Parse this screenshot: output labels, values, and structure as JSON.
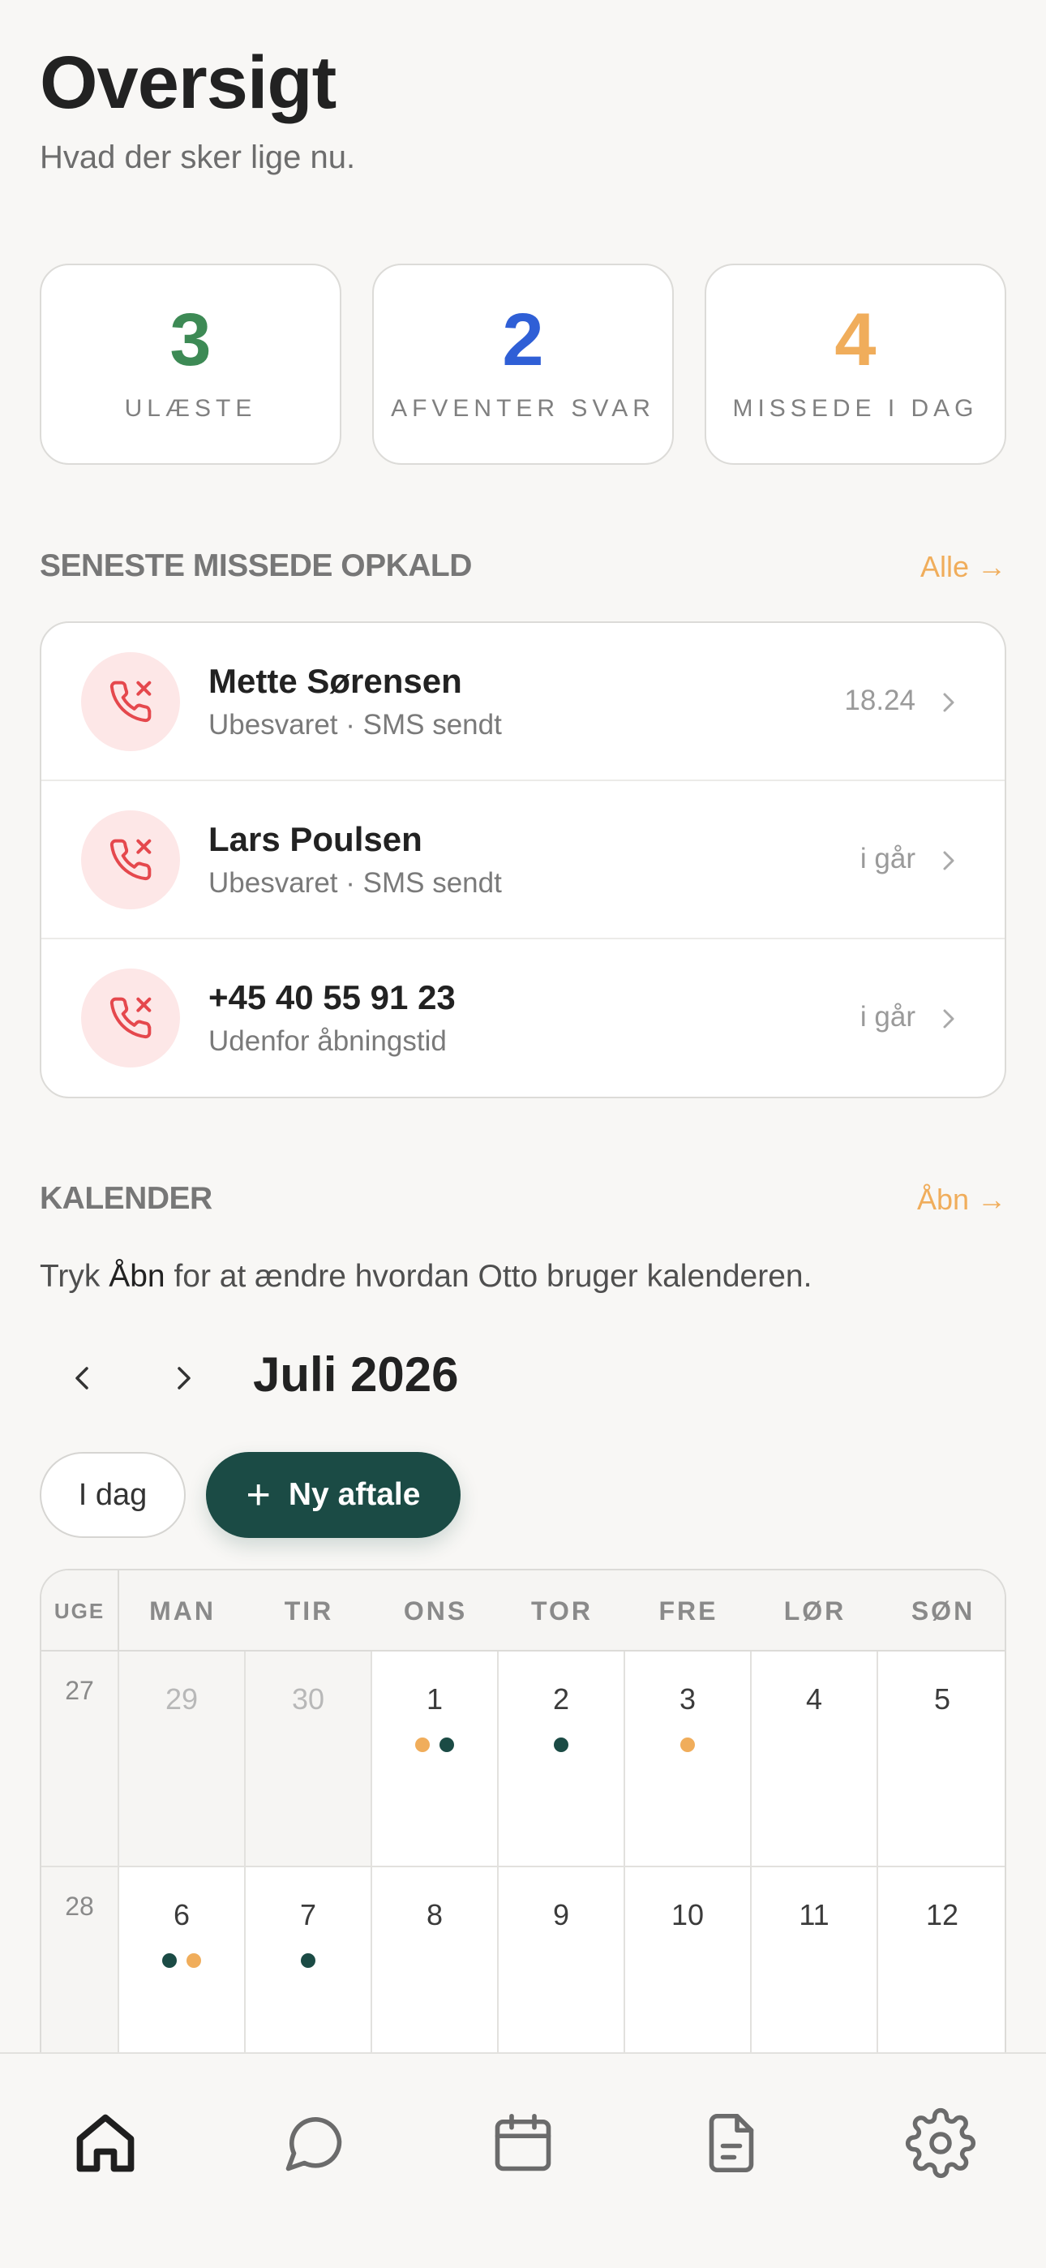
{
  "header": {
    "title": "Oversigt",
    "subtitle": "Hvad der sker lige nu."
  },
  "stats": [
    {
      "value": "3",
      "label": "ULÆSTE",
      "color": "#3d8a55"
    },
    {
      "value": "2",
      "label": "AFVENTER SVAR",
      "color": "#2f5fd6"
    },
    {
      "value": "4",
      "label": "MISSEDE I DAG",
      "color": "#f0ad5b"
    }
  ],
  "missed_calls": {
    "heading": "SENESTE MISSEDE OPKALD",
    "link": "Alle →",
    "items": [
      {
        "name": "Mette Sørensen",
        "status": "Ubesvaret · SMS sendt",
        "time": "18.24",
        "icon": "missed-call-icon"
      },
      {
        "name": "Lars Poulsen",
        "status": "Ubesvaret · SMS sendt",
        "time": "i går",
        "icon": "missed-call-icon"
      },
      {
        "name": "+45 40 55 91 23",
        "status": "Udenfor åbningstid",
        "time": "i går",
        "icon": "missed-call-icon"
      }
    ]
  },
  "calendar": {
    "heading": "KALENDER",
    "link": "Åbn →",
    "note_prefix": "Tryk ",
    "note_bold": "Åbn",
    "note_suffix": " for at ændre hvordan Otto bruger kalenderen.",
    "month": "Juli 2026",
    "today_label": "I dag",
    "new_label": "Ny aftale",
    "week_header": "UGE",
    "days": [
      "MAN",
      "TIR",
      "ONS",
      "TOR",
      "FRE",
      "LØR",
      "SØN"
    ],
    "weeks": [
      {
        "week": "27",
        "dates": [
          {
            "d": "29",
            "muted": true,
            "dots": []
          },
          {
            "d": "30",
            "muted": true,
            "dots": []
          },
          {
            "d": "1",
            "dots": [
              "o",
              "g"
            ]
          },
          {
            "d": "2",
            "dots": [
              "g"
            ]
          },
          {
            "d": "3",
            "dots": [
              "o"
            ]
          },
          {
            "d": "4",
            "dots": []
          },
          {
            "d": "5",
            "dots": []
          }
        ]
      },
      {
        "week": "28",
        "dates": [
          {
            "d": "6",
            "dots": [
              "g",
              "o"
            ]
          },
          {
            "d": "7",
            "dots": [
              "g"
            ]
          },
          {
            "d": "8",
            "dots": []
          },
          {
            "d": "9",
            "dots": []
          },
          {
            "d": "10",
            "dots": []
          },
          {
            "d": "11",
            "dots": []
          },
          {
            "d": "12",
            "dots": []
          }
        ]
      }
    ],
    "dot_colors": {
      "o": "#f0ad5b",
      "g": "#1b4b45"
    }
  },
  "tabbar": {
    "items": [
      {
        "icon": "home-icon",
        "active": true
      },
      {
        "icon": "chat-icon",
        "active": false
      },
      {
        "icon": "calendar-icon",
        "active": false
      },
      {
        "icon": "document-icon",
        "active": false
      },
      {
        "icon": "settings-icon",
        "active": false
      }
    ]
  }
}
